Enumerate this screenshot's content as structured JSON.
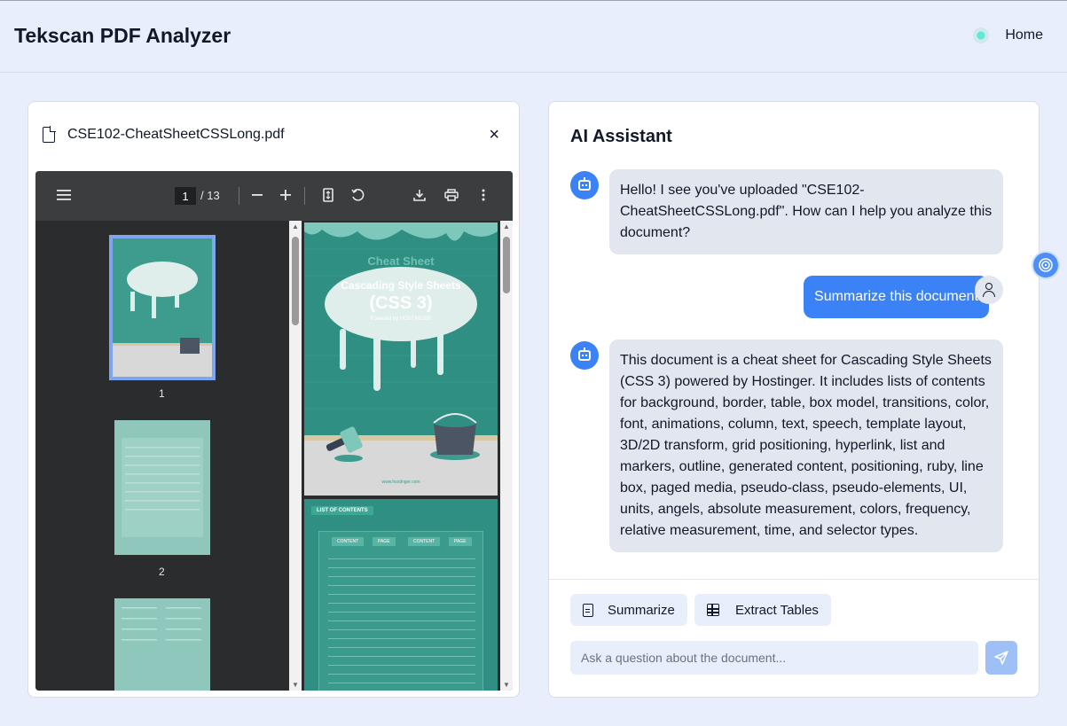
{
  "header": {
    "title": "Tekscan PDF Analyzer",
    "home_label": "Home"
  },
  "pdf_panel": {
    "file_name": "CSE102-CheatSheetCSSLong.pdf",
    "close_glyph": "×",
    "toolbar": {
      "current_page": "1",
      "page_total": "/ 13"
    },
    "thumbnails": [
      {
        "label": "1"
      },
      {
        "label": "2"
      }
    ],
    "page1": {
      "cheat": "Cheat Sheet",
      "title": "Cascading Style Sheets",
      "subtitle": "(CSS 3)",
      "powered": "Powered by HOSTINGER",
      "site": "www.hostinger.com"
    },
    "page2": {
      "tag": "LIST OF CONTENTS",
      "headers": [
        "CONTENT",
        "PAGE",
        "CONTENT",
        "PAGE"
      ]
    }
  },
  "chat": {
    "title": "AI Assistant",
    "messages": [
      {
        "role": "assistant",
        "text": "Hello! I see you've uploaded \"CSE102-CheatSheetCSSLong.pdf\". How can I help you analyze this document?"
      },
      {
        "role": "user",
        "text": "Summarize this document"
      },
      {
        "role": "assistant",
        "text": "This document is a cheat sheet for Cascading Style Sheets (CSS 3) powered by Hostinger. It includes lists of contents for background, border, table, box model, transitions, color, font, animations, column, text, speech, template layout, 3D/2D transform, grid positioning, hyperlink, list and markers, outline, generated content, positioning, ruby, line box, paged media, pseudo-class, pseudo-elements, UI, units, angels, absolute measurement, colors, frequency, relative measurement, time, and selector types."
      }
    ],
    "actions": {
      "summarize": "Summarize",
      "extract_tables": "Extract Tables"
    },
    "input": {
      "placeholder": "Ask a question about the document...",
      "value": ""
    }
  },
  "colors": {
    "accent": "#3b82f6",
    "page_bg": "#e8eefb",
    "pdf_teal": "#2f8f82"
  }
}
